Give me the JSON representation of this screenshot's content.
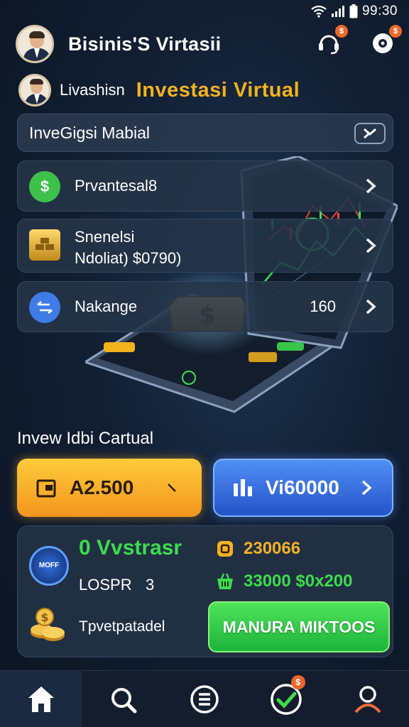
{
  "status_bar": {
    "time": "99:30"
  },
  "header": {
    "title": "Bisinis'S Virtasii"
  },
  "sub_header": {
    "name": "Livashisn",
    "title": "Investasi  Virtual"
  },
  "search": {
    "label": "InveGigsi Mabial"
  },
  "menu": [
    {
      "label": "Prvantesal8",
      "icon": "dollar-icon",
      "value": ""
    },
    {
      "label": "Snenelsi",
      "sublabel": "Ndoliat) $0790)",
      "icon": "gold-bars-icon"
    },
    {
      "label": "Nakange",
      "icon": "exchange-icon",
      "value": "160"
    }
  ],
  "invest": {
    "section_title": "Invew Idbi Cartual",
    "orange_button": "A2.500",
    "blue_button": "Vi60000"
  },
  "stats": {
    "title": "0 Vvstrasr",
    "coin_value": "230066",
    "label": "LOSPR",
    "label_value": "3",
    "money_value": "33000 $0x200",
    "footer_label": "Tpvetpatadel",
    "action_button": "MANURA MIKTOOS",
    "gauge_text": "MOFF"
  },
  "bottom_nav": {
    "items": [
      "home-icon",
      "search-icon",
      "list-icon",
      "check-icon",
      "profile-icon"
    ],
    "badge": "$"
  },
  "colors": {
    "accent_gold": "#f5b21f",
    "accent_green": "#3ddc4e",
    "accent_blue": "#2f67e0",
    "badge_orange": "#e9692c",
    "background": "#121f33"
  }
}
